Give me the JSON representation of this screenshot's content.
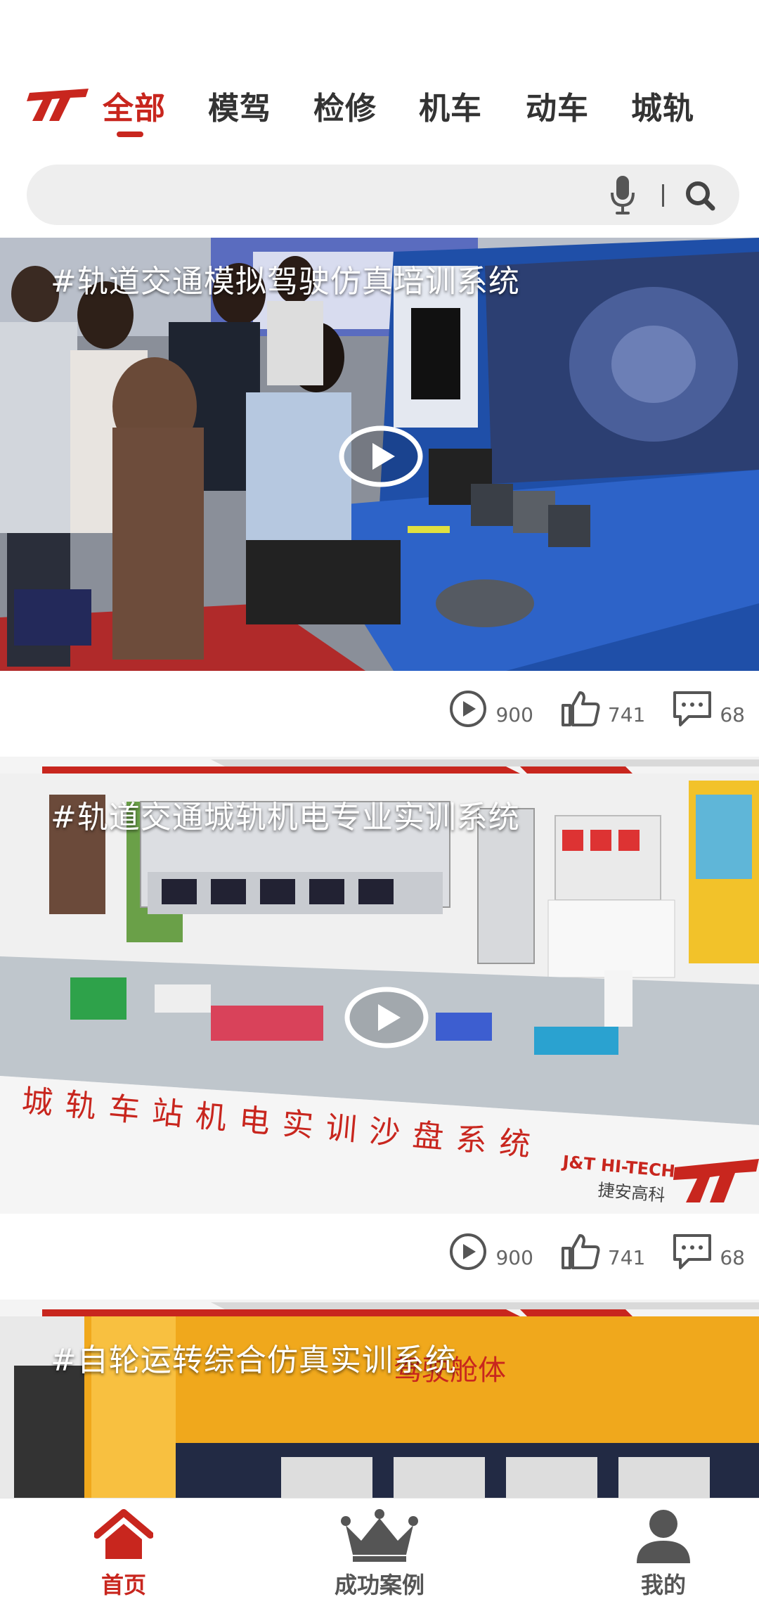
{
  "tabs": [
    "全部",
    "模驾",
    "检修",
    "机车",
    "动车",
    "城轨"
  ],
  "active_tab": "全部",
  "search": {
    "value": "",
    "placeholder": ""
  },
  "cards": [
    {
      "title": "#轨道交通模拟驾驶仿真培训系统",
      "plays": "900",
      "likes": "741",
      "comments": "68"
    },
    {
      "title": "#轨道交通城轨机电专业实训系统",
      "banner_text": "城轨车站机电实训沙盘系统",
      "brand_en": "J&T HI-TECH",
      "brand_cn": "捷安高科",
      "plays": "900",
      "likes": "741",
      "comments": "68"
    },
    {
      "title": "#自轮运转综合仿真实训系统",
      "bg_text": "驾驶舱体"
    }
  ],
  "bottom_nav": [
    {
      "label": "首页",
      "icon": "home-icon",
      "active": true
    },
    {
      "label": "成功案例",
      "icon": "crown-icon",
      "active": false
    },
    {
      "label": "我的",
      "icon": "user-icon",
      "active": false
    }
  ],
  "colors": {
    "accent": "#c8261e",
    "text": "#333333",
    "muted": "#666666"
  }
}
